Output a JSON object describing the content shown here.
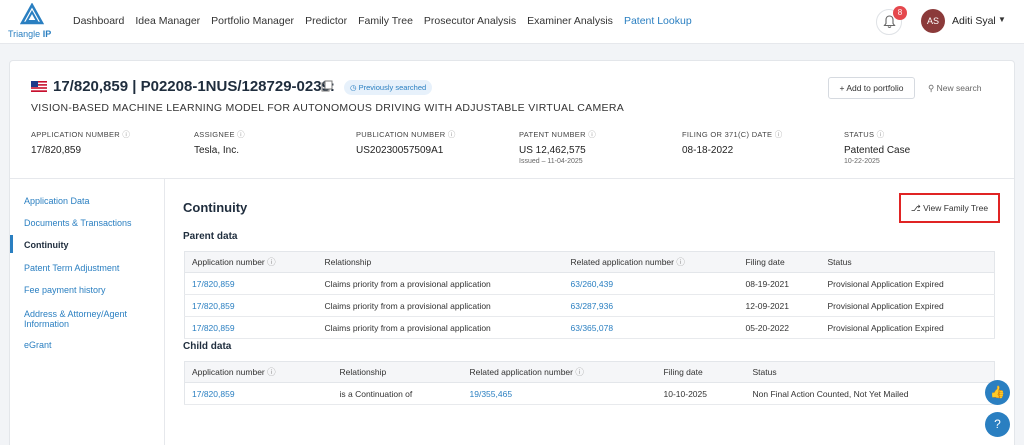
{
  "brand": {
    "name_part1": "Triangle",
    "name_part2": "IP",
    "color": "#2a7fc1"
  },
  "nav": {
    "items": [
      {
        "label": "Dashboard"
      },
      {
        "label": "Idea Manager"
      },
      {
        "label": "Portfolio Manager"
      },
      {
        "label": "Predictor"
      },
      {
        "label": "Family Tree"
      },
      {
        "label": "Prosecutor Analysis"
      },
      {
        "label": "Examiner Analysis"
      },
      {
        "label": "Patent Lookup"
      }
    ],
    "active": "Patent Lookup",
    "notifications": "8",
    "user_initials": "AS",
    "user_name": "Aditi Syal"
  },
  "header": {
    "title": "17/820,859 | P02208-1NUS/128729-0239:",
    "badge": "Previously searched",
    "subtitle": "VISION-BASED MACHINE LEARNING MODEL FOR AUTONOMOUS DRIVING WITH ADJUSTABLE VIRTUAL CAMERA",
    "add_portfolio": "+ Add to portfolio",
    "new_search": "New search"
  },
  "meta": [
    {
      "label": "APPLICATION NUMBER",
      "value": "17/820,859",
      "sub": ""
    },
    {
      "label": "ASSIGNEE",
      "value": "Tesla, Inc.",
      "sub": ""
    },
    {
      "label": "PUBLICATION NUMBER",
      "value": "US20230057509A1",
      "sub": ""
    },
    {
      "label": "PATENT NUMBER",
      "value": "US 12,462,575",
      "sub": "Issued – 11-04-2025"
    },
    {
      "label": "FILING OR 371(C) DATE",
      "value": "08-18-2022",
      "sub": ""
    },
    {
      "label": "STATUS",
      "value": "Patented Case",
      "sub": "10-22-2025"
    }
  ],
  "sidebar": {
    "items": [
      {
        "label": "Application Data"
      },
      {
        "label": "Documents & Transactions"
      },
      {
        "label": "Continuity"
      },
      {
        "label": "Patent Term Adjustment"
      },
      {
        "label": "Fee payment history"
      },
      {
        "label": "Address & Attorney/Agent Information"
      },
      {
        "label": "eGrant"
      }
    ],
    "active": "Continuity"
  },
  "continuity": {
    "title": "Continuity",
    "view_family_tree": "View Family Tree",
    "parent": {
      "title": "Parent data",
      "headers": [
        "Application number",
        "Relationship",
        "Related application number",
        "Filing date",
        "Status"
      ],
      "rows": [
        [
          "17/820,859",
          "Claims priority from a provisional application",
          "63/260,439",
          "08-19-2021",
          "Provisional Application Expired"
        ],
        [
          "17/820,859",
          "Claims priority from a provisional application",
          "63/287,936",
          "12-09-2021",
          "Provisional Application Expired"
        ],
        [
          "17/820,859",
          "Claims priority from a provisional application",
          "63/365,078",
          "05-20-2022",
          "Provisional Application Expired"
        ]
      ]
    },
    "child": {
      "title": "Child data",
      "headers": [
        "Application number",
        "Relationship",
        "Related application number",
        "Filing date",
        "Status"
      ],
      "rows": [
        [
          "17/820,859",
          "is a Continuation of",
          "19/355,465",
          "10-10-2025",
          "Non Final Action Counted, Not Yet Mailed"
        ]
      ]
    }
  },
  "fabs": {
    "like_icon": "thumbs-up-icon",
    "help_label": "?"
  }
}
